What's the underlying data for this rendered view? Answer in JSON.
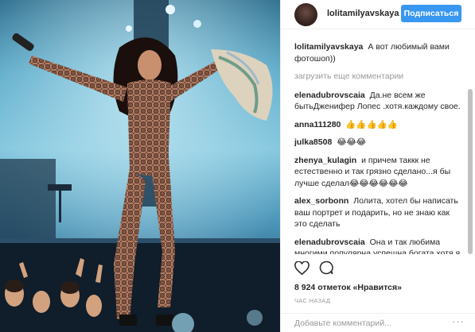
{
  "header": {
    "username": "lolitamilyavskaya",
    "follow_label": "Подписаться"
  },
  "caption": {
    "user": "lolitamilyavskaya",
    "text": "А вот любимый вами фотошоп))"
  },
  "load_more_label": "загрузить еще комментарии",
  "comments": [
    {
      "user": "elenadubrovscaia",
      "text": "Да.не всем же бытьДженифер Лопес .хотя.каждому свое."
    },
    {
      "user": "anna111280",
      "text": "👍👍👍👍👍"
    },
    {
      "user": "julka8508",
      "text": "😂😂😂"
    },
    {
      "user": "zhenya_kulagin",
      "text": "и причем таккк не естественно и так грязно сделано...я бы лучше сделал😂😂😂😂😂😂"
    },
    {
      "user": "alex_sorbonn",
      "text": "Лолита, хотел бы написать ваш портрет и подарить, но не знаю как это сделать"
    },
    {
      "user": "elenadubrovscaia",
      "text": "Она и так любима многими.популярна.успешна.богата.хотя я люблю Дж Ло.Но это же мои проблемы а не Лолиты"
    }
  ],
  "actions": {
    "like_icon": "heart-icon",
    "comment_icon": "speech-bubble-icon"
  },
  "likes_text": "8 924 отметок «Нравится»",
  "time_text": "ЧАС НАЗАД",
  "add_comment": {
    "placeholder": "Добавьте комментарий...",
    "more_label": "···"
  },
  "colors": {
    "accent": "#3897f0",
    "text": "#262626",
    "muted": "#999999",
    "divider": "#efefef"
  }
}
